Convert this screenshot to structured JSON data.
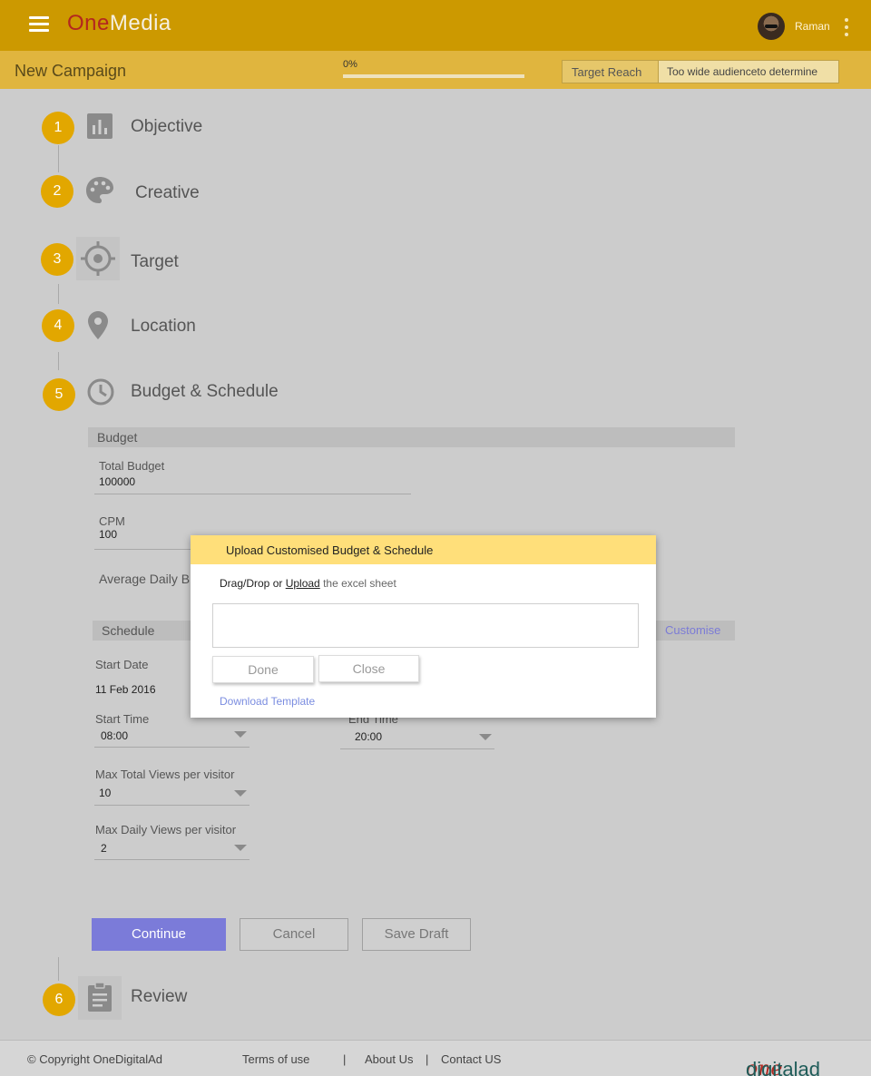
{
  "app": {
    "logo_one": "One",
    "logo_media": "Media",
    "user_name": "Raman"
  },
  "campaign": {
    "title": "New Campaign",
    "progress_label": "0%",
    "progress_fraction": 0,
    "target_reach_label": "Target Reach",
    "target_reach_value": "Too wide audienceto determine"
  },
  "steps": [
    {
      "num": "1",
      "label": "Objective",
      "icon": "bar-chart-icon"
    },
    {
      "num": "2",
      "label": "Creative",
      "icon": "palette-icon"
    },
    {
      "num": "3",
      "label": "Target",
      "icon": "target-icon"
    },
    {
      "num": "4",
      "label": "Location",
      "icon": "map-pin-icon"
    },
    {
      "num": "5",
      "label": "Budget & Schedule",
      "icon": "clock-icon"
    },
    {
      "num": "6",
      "label": "Review",
      "icon": "clipboard-icon"
    }
  ],
  "budget": {
    "section_title": "Budget",
    "total_budget_label": "Total Budget",
    "total_budget_value": "100000",
    "cpm_label": "CPM",
    "cpm_value": "100",
    "avg_daily_label": "Average Daily B"
  },
  "schedule": {
    "section_title": "Schedule",
    "customise_link": "Customise",
    "start_date_label": "Start Date",
    "start_date_value": "11 Feb 2016",
    "start_time_label": "Start Time",
    "start_time_value": "08:00",
    "end_time_label": "End Time",
    "end_time_value": "20:00",
    "max_total_label": "Max Total Views  per visitor",
    "max_total_value": "10",
    "max_daily_label": "Max Daily Views per visitor",
    "max_daily_value": "2"
  },
  "actions": {
    "continue": "Continue",
    "cancel": "Cancel",
    "save_draft": "Save Draft"
  },
  "modal": {
    "title": "Upload Customised Budget & Schedule",
    "instruction_prefix": "Drag/Drop or ",
    "instruction_link": "Upload",
    "instruction_suffix": " the excel sheet",
    "done": "Done",
    "close": "Close",
    "download_template": "Download Template"
  },
  "footer": {
    "copyright": "© Copyright OneDigitalAd",
    "terms": "Terms of use",
    "sep1": "|",
    "about": "About Us",
    "sep2": "|",
    "contact": "Contact US",
    "logo_one": "one",
    "logo_rest": "digitalad"
  },
  "colors": {
    "brand_header": "#cc9900",
    "step_badge": "#e2a700",
    "primary_button": "#7b7bd9",
    "modal_header": "#ffdf7a"
  }
}
